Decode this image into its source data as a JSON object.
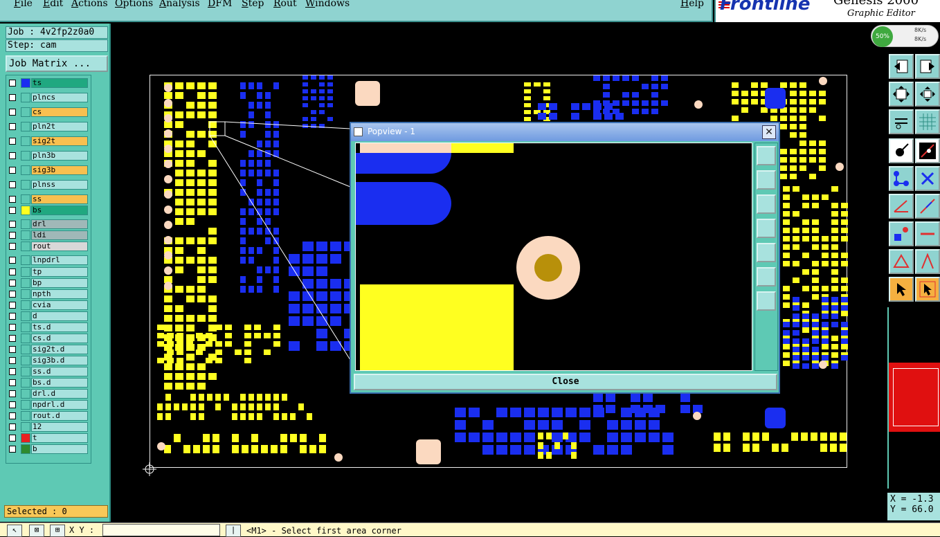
{
  "menu": [
    "File",
    "Edit",
    "Actions",
    "Options",
    "Analysis",
    "DFM",
    "Step",
    "Rout",
    "Windows"
  ],
  "help": "Help",
  "brand": {
    "logo": "Frontline",
    "product": "Genesis 2000",
    "subtitle": "Graphic Editor"
  },
  "network": {
    "percent": "50%",
    "up": "8K/s",
    "down": "8K/s"
  },
  "job": "Job : 4v2fp2z0a0",
  "step": "Step: cam",
  "job_matrix": "Job Matrix ...",
  "layers": [
    {
      "name": "ts",
      "color": "#20a880",
      "swatch": "#1a2ef0"
    },
    {
      "name": "plncs",
      "color": "#a8e2de",
      "swatch": ""
    },
    {
      "name": "cs",
      "color": "#f8c050",
      "swatch": ""
    },
    {
      "name": "pln2t",
      "color": "#a8e2de",
      "swatch": ""
    },
    {
      "name": "sig2t",
      "color": "#f8c050",
      "swatch": ""
    },
    {
      "name": "pln3b",
      "color": "#a8e2de",
      "swatch": ""
    },
    {
      "name": "sig3b",
      "color": "#f8c050",
      "swatch": ""
    },
    {
      "name": "plnss",
      "color": "#a8e2de",
      "swatch": ""
    },
    {
      "name": "ss",
      "color": "#f8c050",
      "swatch": ""
    },
    {
      "name": "bs",
      "color": "#20a880",
      "swatch": "#ffff20"
    },
    {
      "name": "drl",
      "color": "#a0b8b8",
      "swatch": ""
    },
    {
      "name": "ldi",
      "color": "#a0b8b8",
      "swatch": ""
    },
    {
      "name": "rout",
      "color": "#d8d8d8",
      "swatch": ""
    },
    {
      "name": "lnpdrl",
      "color": "#a8e2de",
      "swatch": ""
    },
    {
      "name": "tp",
      "color": "#a8e2de",
      "swatch": ""
    },
    {
      "name": "bp",
      "color": "#a8e2de",
      "swatch": ""
    },
    {
      "name": "npth",
      "color": "#a8e2de",
      "swatch": ""
    },
    {
      "name": "cvia",
      "color": "#a8e2de",
      "swatch": ""
    },
    {
      "name": "d",
      "color": "#a8e2de",
      "swatch": ""
    },
    {
      "name": "ts.d",
      "color": "#a8e2de",
      "swatch": ""
    },
    {
      "name": "cs.d",
      "color": "#a8e2de",
      "swatch": ""
    },
    {
      "name": "sig2t.d",
      "color": "#a8e2de",
      "swatch": ""
    },
    {
      "name": "sig3b.d",
      "color": "#a8e2de",
      "swatch": ""
    },
    {
      "name": "ss.d",
      "color": "#a8e2de",
      "swatch": ""
    },
    {
      "name": "bs.d",
      "color": "#a8e2de",
      "swatch": ""
    },
    {
      "name": "drl.d",
      "color": "#a8e2de",
      "swatch": ""
    },
    {
      "name": "npdrl.d",
      "color": "#a8e2de",
      "swatch": ""
    },
    {
      "name": "rout.d",
      "color": "#a8e2de",
      "swatch": ""
    },
    {
      "name": "12",
      "color": "#a8e2de",
      "swatch": ""
    },
    {
      "name": "t",
      "color": "#a8e2de",
      "swatch": "#e82020"
    },
    {
      "name": "b",
      "color": "#a8e2de",
      "swatch": "#2e8a2e"
    }
  ],
  "selected": "Selected : 0",
  "status": {
    "xy_label": "X Y :",
    "message": "<M1> - Select first area corner"
  },
  "coords": {
    "x": "X = -1.3",
    "y": "Y = 66.0"
  },
  "popview": {
    "title": "Popview - 1",
    "close_label": "Close"
  },
  "colors": {
    "panel": "#5ec9b4",
    "pad_blue": "#1a2ef0",
    "pad_yellow": "#ffff20",
    "pad_peach": "#fbd9c0"
  }
}
